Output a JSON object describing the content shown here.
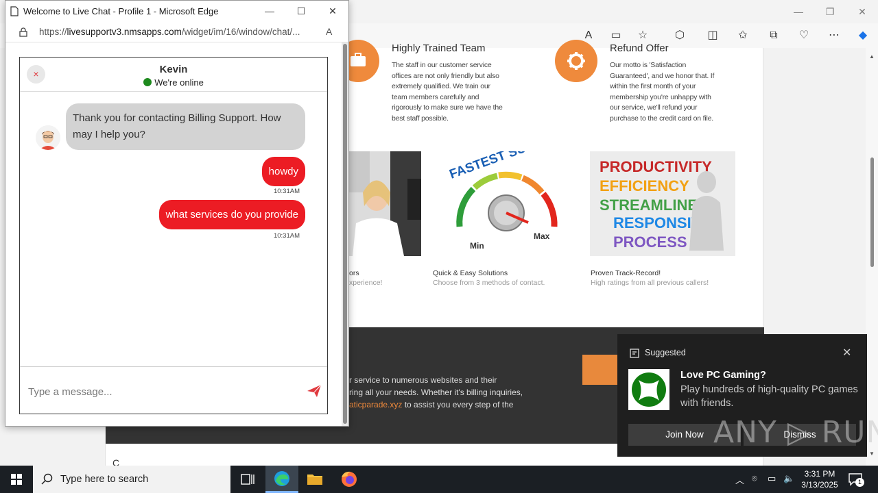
{
  "chat_window": {
    "title": "Welcome to Live Chat - Profile 1 - Microsoft Edge",
    "url_prefix": "https://",
    "url_domain": "livesupportv3.nmsapps.com",
    "url_path": "/widget/im/16/window/chat/..."
  },
  "chat": {
    "close_label": "×",
    "agent_name": "Kevin",
    "status": "We're online",
    "messages": [
      {
        "from": "agent",
        "text": "Thank you for contacting Billing Support. How may I help you?",
        "time": ""
      },
      {
        "from": "user",
        "text": "howdy",
        "time": "10:31AM"
      },
      {
        "from": "user",
        "text": "what services do you provide",
        "time": "10:31AM"
      }
    ],
    "input_placeholder": "Type a message..."
  },
  "background_page": {
    "feature_left_title": "Highly Trained Team",
    "feature_left_text": "The staff in our customer service offices are not only friendly but also extremely qualified. We train our team members carefully and rigorously to make sure we have the best staff possible.",
    "feature_right_title": "Refund Offer",
    "feature_right_text": "Our motto is 'Satisfaction Guaranteed', and we honor that. If within the first month of your membership you're unhappy with our service, we'll refund your purchase to the credit card on file.",
    "img1_caption": "ors",
    "img1_sub": "xperience!",
    "img2_caption": "Quick & Easy Solutions",
    "img2_sub": "Choose from 3 methods of contact.",
    "img3_caption": "Proven Track-Record!",
    "img3_sub": "High ratings from all previous callers!",
    "gauge_top": "FASTEST SUPPORT",
    "gauge_min": "Min",
    "gauge_max": "Max",
    "words": [
      "PRODUCTIVITY",
      "EFFICIENCY",
      "STREAMLINED",
      "RESPONSIVE",
      "PROCESS"
    ],
    "dark_line1": "r service to numerous websites and their",
    "dark_line2": "ring all your needs. Whether it's billing inquiries,",
    "dark_link": "aticparade.xyz",
    "dark_line3_rest": " to assist you every step of the",
    "bottom_text": "C"
  },
  "toast": {
    "header": "Suggested",
    "title": "Love PC Gaming?",
    "body": "Play hundreds of high-quality PC games with friends.",
    "primary_button": "Join Now",
    "secondary_button": "Dismiss"
  },
  "watermark": "ANY ▷ RUN",
  "taskbar": {
    "search_placeholder": "Type here to search",
    "time": "3:31 PM",
    "date": "3/13/2025",
    "notification_count": "1"
  },
  "colors": {
    "accent_orange": "#ef8a3c",
    "user_bubble": "#ec1c24",
    "agent_bubble": "#d3d3d3",
    "online_dot": "#1e8a1e"
  }
}
